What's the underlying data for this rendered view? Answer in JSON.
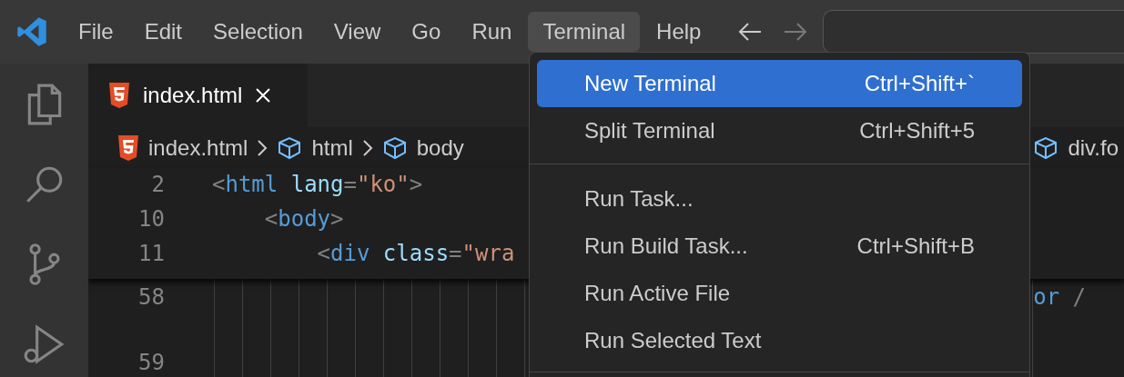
{
  "menubar": {
    "items": [
      {
        "label": "File",
        "selected": false
      },
      {
        "label": "Edit",
        "selected": false
      },
      {
        "label": "Selection",
        "selected": false
      },
      {
        "label": "View",
        "selected": false
      },
      {
        "label": "Go",
        "selected": false
      },
      {
        "label": "Run",
        "selected": false
      },
      {
        "label": "Terminal",
        "selected": true
      },
      {
        "label": "Help",
        "selected": false
      }
    ]
  },
  "tabs": [
    {
      "label": "index.html",
      "selected": true
    }
  ],
  "breadcrumbs": [
    {
      "kind": "file",
      "label": "index.html"
    },
    {
      "kind": "element",
      "label": "html"
    },
    {
      "kind": "element",
      "label": "body"
    },
    {
      "kind": "element",
      "label": "div.fo"
    }
  ],
  "sticky_lines": [
    {
      "number": "2",
      "tokens": [
        {
          "kind": "punct",
          "text": "<"
        },
        {
          "kind": "tag",
          "text": "html"
        },
        {
          "kind": "attr",
          "text": " lang"
        },
        {
          "kind": "punct",
          "text": "="
        },
        {
          "kind": "string",
          "text": "\"ko\""
        },
        {
          "kind": "punct",
          "text": ">"
        }
      ]
    },
    {
      "number": "10",
      "tokens": [
        {
          "kind": "punct",
          "text": "    <"
        },
        {
          "kind": "tag",
          "text": "body"
        },
        {
          "kind": "punct",
          "text": ">"
        }
      ]
    },
    {
      "number": "11",
      "tokens": [
        {
          "kind": "punct",
          "text": "        <"
        },
        {
          "kind": "tag",
          "text": "div"
        },
        {
          "kind": "attr",
          "text": " class"
        },
        {
          "kind": "punct",
          "text": "="
        },
        {
          "kind": "string",
          "text": "\"wra"
        }
      ]
    }
  ],
  "lines": [
    {
      "number": "58",
      "tokens": [
        {
          "kind": "tag",
          "text": "or"
        },
        {
          "kind": "punct",
          "text": " /"
        }
      ]
    },
    {
      "number": "59"
    }
  ],
  "terminal_menu": {
    "groups": [
      [
        {
          "label": "New Terminal",
          "shortcut": "Ctrl+Shift+`",
          "selected": true
        },
        {
          "label": "Split Terminal",
          "shortcut": "Ctrl+Shift+5",
          "selected": false
        }
      ],
      [
        {
          "label": "Run Task...",
          "selected": false
        },
        {
          "label": "Run Build Task...",
          "shortcut": "Ctrl+Shift+B",
          "selected": false
        },
        {
          "label": "Run Active File",
          "selected": false
        },
        {
          "label": "Run Selected Text",
          "selected": false
        }
      ]
    ]
  }
}
